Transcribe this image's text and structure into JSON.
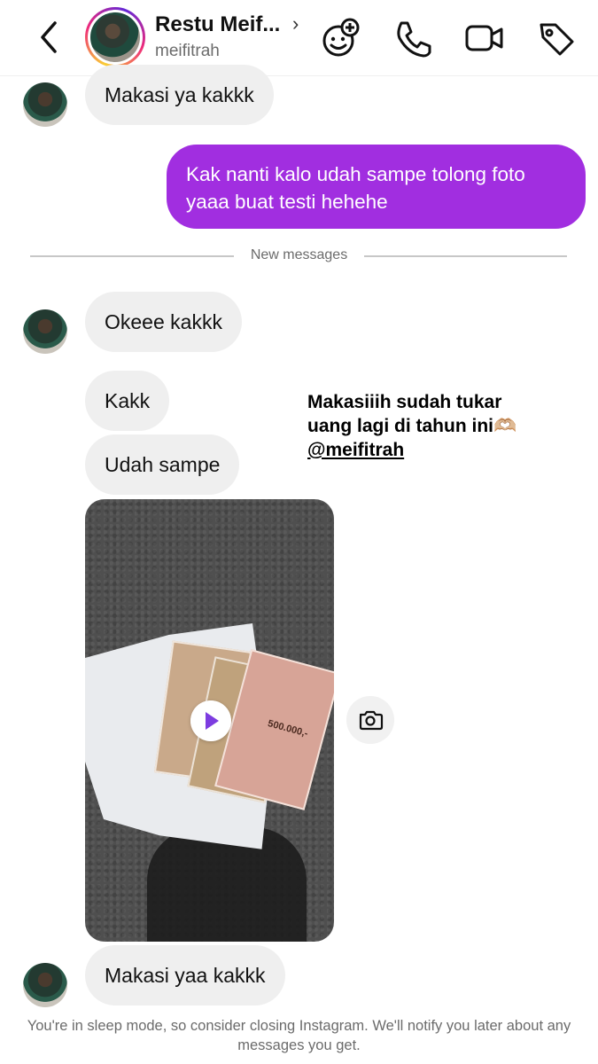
{
  "header": {
    "name": "Restu Meif...",
    "username": "meifitrah",
    "icons": {
      "back": "back-chevron-icon",
      "effects": "add-effects-icon",
      "call": "phone-icon",
      "video": "video-camera-icon",
      "tag": "tag-icon"
    }
  },
  "messages": {
    "m1": "Makasi ya kakkk",
    "m2": "Kak nanti kalo udah sampe tolong foto yaaa buat testi hehehe",
    "divider": "New messages",
    "m3": "Okeee kakkk",
    "m4": "Kakk",
    "m5": "Udah sampe",
    "m6": "Makasi yaa kakkk"
  },
  "story": {
    "line1": "Makasiiih sudah tukar",
    "line2": "uang lagi di tahun ini🫶🏼",
    "line3": "@meifitrah"
  },
  "photo": {
    "banknote_label": "500.000,-"
  },
  "footer": {
    "text": "You're in sleep mode, so consider closing Instagram. We'll notify you later about any messages you get."
  },
  "colors": {
    "outgoing_bubble": "#a12ee0",
    "incoming_bubble": "#efefef",
    "muted_text": "#6b6b6b"
  }
}
